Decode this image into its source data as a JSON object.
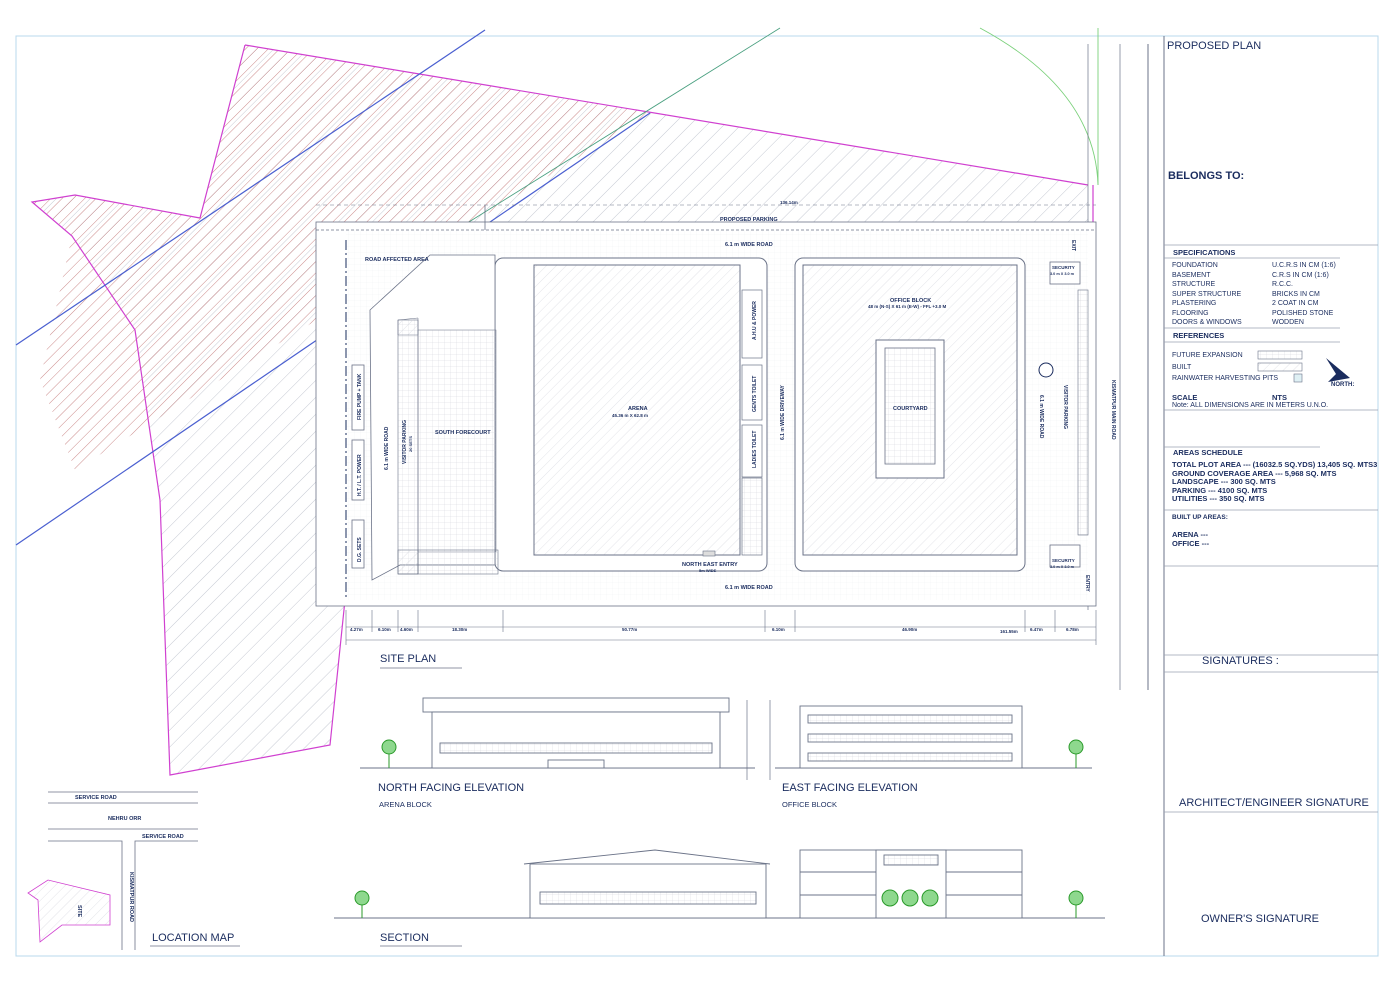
{
  "title_block": {
    "title": "PROPOSED PLAN",
    "belongs_to": "BELONGS TO:",
    "specifications_header": "SPECIFICATIONS",
    "specifications": [
      {
        "label": "FOUNDATION",
        "value": "U.C.R.S IN CM (1:6)"
      },
      {
        "label": "BASEMENT",
        "value": "C.R.S IN CM (1:6)"
      },
      {
        "label": "STRUCTURE",
        "value": "R.C.C."
      },
      {
        "label": "SUPER STRUCTURE",
        "value": "BRICKS IN CM"
      },
      {
        "label": "PLASTERING",
        "value": "2 COAT IN CM"
      },
      {
        "label": "FLOORING",
        "value": "POLISHED STONE"
      },
      {
        "label": "DOORS & WINDOWS",
        "value": "WODDEN"
      }
    ],
    "references_header": "REFERENCES",
    "references": [
      "FUTURE EXPANSION",
      "BUILT",
      "RAINWATER HARVESTING PITS"
    ],
    "north_label": "NORTH:",
    "scale_label": "SCALE",
    "scale_value": "NTS",
    "note": "Note: ALL DIMENSIONS ARE IN METERS U.N.O.",
    "areas_header": "AREAS SCHEDULE",
    "areas": [
      "TOTAL PLOT AREA --- (16032.5 SQ.YDS) 13,405 SQ. MTS3",
      "GROUND COVERAGE AREA --- 5,968 SQ. MTS",
      "LANDSCAPE --- 300 SQ. MTS",
      "PARKING --- 4100 SQ. MTS",
      "UTILITIES --- 350 SQ. MTS"
    ],
    "built_up_header": "BUILT UP AREAS:",
    "built_up": [
      "ARENA ---",
      "OFFICE ---"
    ],
    "signatures": "SIGNATURES :",
    "architect_signature": "ARCHITECT/ENGINEER SIGNATURE",
    "owner_signature": "OWNER'S SIGNATURE"
  },
  "site_plan": {
    "caption": "SITE PLAN",
    "proposed_parking": "PROPOSED PARKING",
    "road_affected": "ROAD AFFECTED AREA",
    "wide_road": "6.1 m WIDE ROAD",
    "wide_driveway": "6.1 m WIDE DRIVEWAY",
    "south_forecourt": "SOUTH FORECOURT",
    "arena": "ARENA",
    "arena_dim": "45.36 m X 62.8 m",
    "office_block": "OFFICE BLOCK",
    "office_dim": "48 m (N-S) X 61 m (E-W) - FFL +3.0 M",
    "courtyard": "COURTYARD",
    "ahu_power": "A.H.U & POWER",
    "gents_toilet": "GENTS TOILET",
    "ladies_toilet": "LADIES TOILET",
    "north_east_entry": "NORTH EAST ENTRY",
    "entry_width": "5m WIDE",
    "visitor_parking": "VISITOR PARKING",
    "visitor_parking_sets": "20 SETS",
    "security": "SECURITY",
    "security_dim": "3.0 m X 3.0 m",
    "fire_pump": "FIRE PUMP + TANK",
    "ht_lt_power": "H.T. / L.T. POWER",
    "dg_sets": "D.G. SETS",
    "exit": "EXIT",
    "entry": "ENTRY",
    "kismatpur_main_road": "KISMATPUR MAIN ROAD",
    "dim_total_width": "161.55m",
    "dim_total_top": "136.14m",
    "dim_segments": [
      "4.27m",
      "6.10m",
      "4.60m",
      "18.30m",
      "50.77m",
      "6.10m",
      "46.90m",
      "6.47m",
      "6.78m"
    ]
  },
  "elevations": {
    "north_title": "NORTH FACING ELEVATION",
    "north_sub": "ARENA BLOCK",
    "east_title": "EAST FACING ELEVATION",
    "east_sub": "OFFICE BLOCK",
    "section_title": "SECTION"
  },
  "location_map": {
    "title": "LOCATION MAP",
    "service_road": "SERVICE ROAD",
    "nehru_orr": "NEHRU ORR",
    "kismatpur_road": "KISMATPUR ROAD",
    "site": "SITE"
  },
  "colors": {
    "ink": "#1a2c5e",
    "property_line": "#d040d0",
    "road_line": "#4a5fd0",
    "hatch": "#c04040",
    "green": "#2a9a2a"
  }
}
